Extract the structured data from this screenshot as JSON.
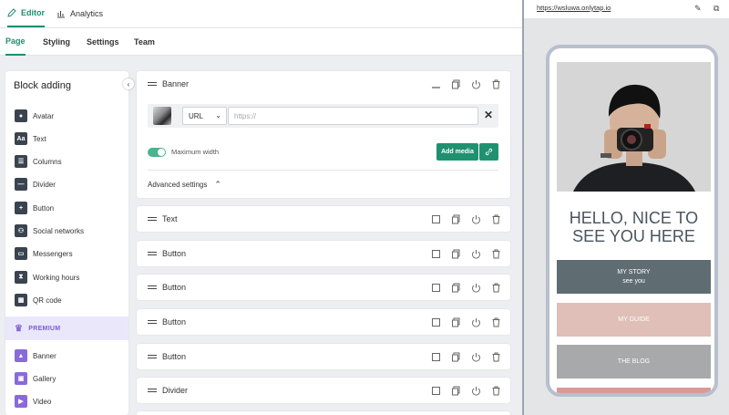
{
  "topbar": {
    "tabs": [
      {
        "label": "Editor",
        "active": true,
        "icon": "pencil-icon"
      },
      {
        "label": "Analytics",
        "active": false,
        "icon": "bar-chart-icon"
      }
    ]
  },
  "subbar": {
    "tabs": [
      {
        "label": "Page",
        "active": true
      },
      {
        "label": "Styling",
        "active": false
      },
      {
        "label": "Settings",
        "active": false
      },
      {
        "label": "Team",
        "active": false
      }
    ]
  },
  "sidebar": {
    "title": "Block adding",
    "items": [
      {
        "label": "Avatar",
        "icon": "avatar-icon"
      },
      {
        "label": "Text",
        "icon": "text-icon",
        "glyph": "Aa"
      },
      {
        "label": "Columns",
        "icon": "columns-icon"
      },
      {
        "label": "Divider",
        "icon": "divider-icon"
      },
      {
        "label": "Button",
        "icon": "button-icon"
      },
      {
        "label": "Social networks",
        "icon": "social-networks-icon"
      },
      {
        "label": "Messengers",
        "icon": "messengers-icon"
      },
      {
        "label": "Working hours",
        "icon": "hourglass-icon"
      },
      {
        "label": "QR code",
        "icon": "qr-code-icon"
      }
    ],
    "premium_label": "PREMIUM",
    "premium_items": [
      {
        "label": "Banner",
        "icon": "banner-icon"
      },
      {
        "label": "Gallery",
        "icon": "gallery-icon"
      },
      {
        "label": "Video",
        "icon": "video-icon"
      }
    ]
  },
  "banner_card": {
    "title": "Banner",
    "select_value": "URL",
    "url_placeholder": "https://",
    "max_width_label": "Maximum width",
    "max_width_on": true,
    "add_media_label": "Add media",
    "advanced_label": "Advanced settings"
  },
  "blocks": [
    {
      "title": "Text"
    },
    {
      "title": "Button"
    },
    {
      "title": "Button"
    },
    {
      "title": "Button"
    },
    {
      "title": "Button"
    },
    {
      "title": "Divider"
    }
  ],
  "preview": {
    "url": "https://wsluwa.onlytap.io",
    "hero_line1": "HELLO, NICE TO",
    "hero_line2": "SEE YOU HERE",
    "buttons": [
      {
        "label": "MY STORY",
        "sub": "see you",
        "color": "#5f6d73"
      },
      {
        "label": "MY GUIDE",
        "sub": "",
        "color": "#dfbfb8"
      },
      {
        "label": "THE BLOG",
        "sub": "",
        "color": "#a8a9ab"
      }
    ],
    "next_button_color": "#d99a97"
  },
  "colors": {
    "accent": "#1e8f6f",
    "premium": "#8a6ad8"
  }
}
